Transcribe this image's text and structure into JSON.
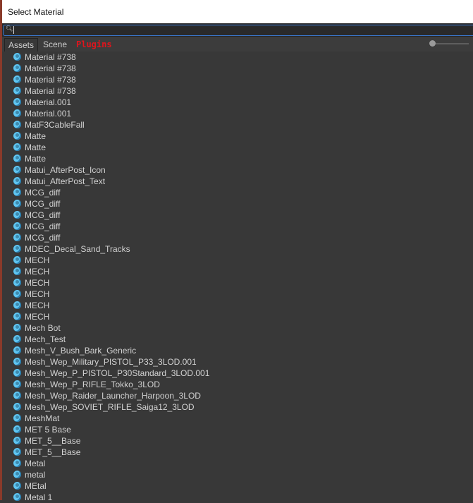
{
  "window": {
    "title": "Select Material"
  },
  "search": {
    "value": "",
    "icon": "search-icon"
  },
  "tabs": [
    {
      "label": "Assets"
    },
    {
      "label": "Scene"
    },
    {
      "label": "Plugins",
      "color": "#e0141c"
    }
  ],
  "items": [
    "Material #738",
    "Material #738",
    "Material #738",
    "Material #738",
    "Material.001",
    "Material.001",
    "MatF3CableFall",
    "Matte",
    "Matte",
    "Matte",
    "Matui_AfterPost_Icon",
    "Matui_AfterPost_Text",
    "MCG_diff",
    "MCG_diff",
    "MCG_diff",
    "MCG_diff",
    "MCG_diff",
    "MDEC_Decal_Sand_Tracks",
    "MECH",
    "MECH",
    "MECH",
    "MECH",
    "MECH",
    "MECH",
    "Mech Bot",
    "Mech_Test",
    "Mesh_V_Bush_Bark_Generic",
    "Mesh_Wep_Military_PISTOL_P33_3LOD.001",
    "Mesh_Wep_P_PISTOL_P30Standard_3LOD.001",
    "Mesh_Wep_P_RIFLE_Tokko_3LOD",
    "Mesh_Wep_Raider_Launcher_Harpoon_3LOD",
    "Mesh_Wep_SOVIET_RIFLE_Saiga12_3LOD",
    "MeshMat",
    "MET 5  Base",
    "MET_5__Base",
    "MET_5__Base",
    "Metal",
    "metal",
    "MEtal",
    "Metal 1"
  ]
}
